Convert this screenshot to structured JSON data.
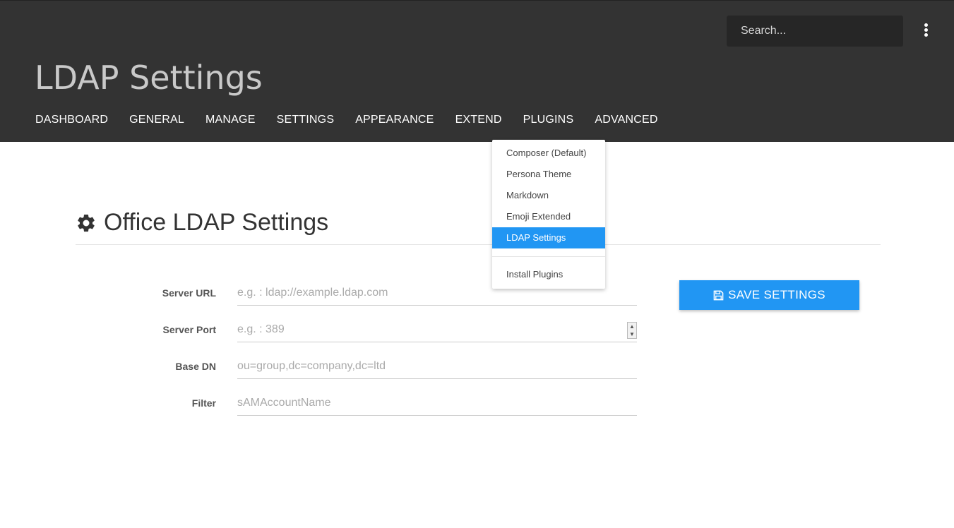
{
  "header": {
    "title": "LDAP Settings",
    "search_placeholder": "Search...",
    "menu_icon": "kebab-menu-icon"
  },
  "nav": {
    "items": [
      {
        "label": "DASHBOARD"
      },
      {
        "label": "GENERAL"
      },
      {
        "label": "MANAGE"
      },
      {
        "label": "SETTINGS"
      },
      {
        "label": "APPEARANCE"
      },
      {
        "label": "EXTEND"
      },
      {
        "label": "PLUGINS"
      },
      {
        "label": "ADVANCED"
      }
    ]
  },
  "plugins_menu": {
    "items": [
      {
        "label": "Composer (Default)"
      },
      {
        "label": "Persona Theme"
      },
      {
        "label": "Markdown"
      },
      {
        "label": "Emoji Extended"
      },
      {
        "label": "LDAP Settings",
        "active": true
      }
    ],
    "install_label": "Install Plugins",
    "active_color": "#2196f3"
  },
  "main": {
    "title": "Office LDAP Settings",
    "title_icon": "gear-icon",
    "fields": [
      {
        "label": "Server URL",
        "placeholder": "e.g. : ldap://example.ldap.com",
        "value": ""
      },
      {
        "label": "Server Port",
        "placeholder": "e.g. : 389",
        "value": ""
      },
      {
        "label": "Base DN",
        "placeholder": "ou=group,dc=company,dc=ltd",
        "value": ""
      },
      {
        "label": "Filter",
        "placeholder": "sAMAccountName",
        "value": ""
      }
    ],
    "save_button": {
      "label": "SAVE SETTINGS",
      "icon": "floppy-disk-icon",
      "color": "#2196f3"
    }
  }
}
